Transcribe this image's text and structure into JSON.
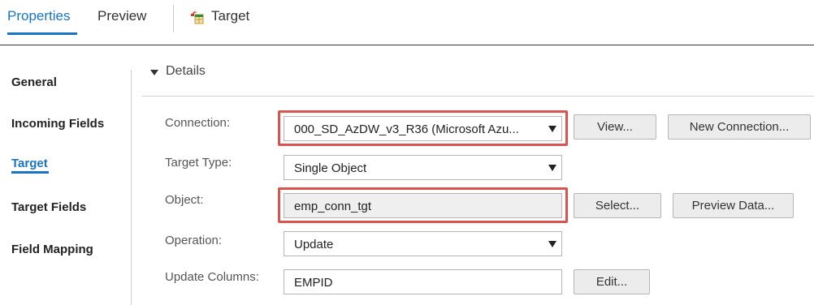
{
  "tabs": {
    "properties": "Properties",
    "preview": "Preview",
    "target": "Target",
    "target_icon": "target-table-icon"
  },
  "nav": {
    "items": [
      "General",
      "Incoming Fields",
      "Target",
      "Target Fields",
      "Field Mapping"
    ],
    "active": "Target"
  },
  "details": {
    "header": "Details",
    "connection": {
      "label": "Connection:",
      "value": "000_SD_AzDW_v3_R36 (Microsoft Azu...",
      "view_button": "View...",
      "new_button": "New Connection..."
    },
    "target_type": {
      "label": "Target Type:",
      "value": "Single Object"
    },
    "object": {
      "label": "Object:",
      "value": "emp_conn_tgt",
      "select_button": "Select...",
      "preview_button": "Preview Data..."
    },
    "operation": {
      "label": "Operation:",
      "value": "Update"
    },
    "update_columns": {
      "label": "Update Columns:",
      "value": "EMPID",
      "edit_button": "Edit..."
    }
  },
  "colors": {
    "accent": "#1a74c5",
    "highlight": "#d9534f"
  }
}
